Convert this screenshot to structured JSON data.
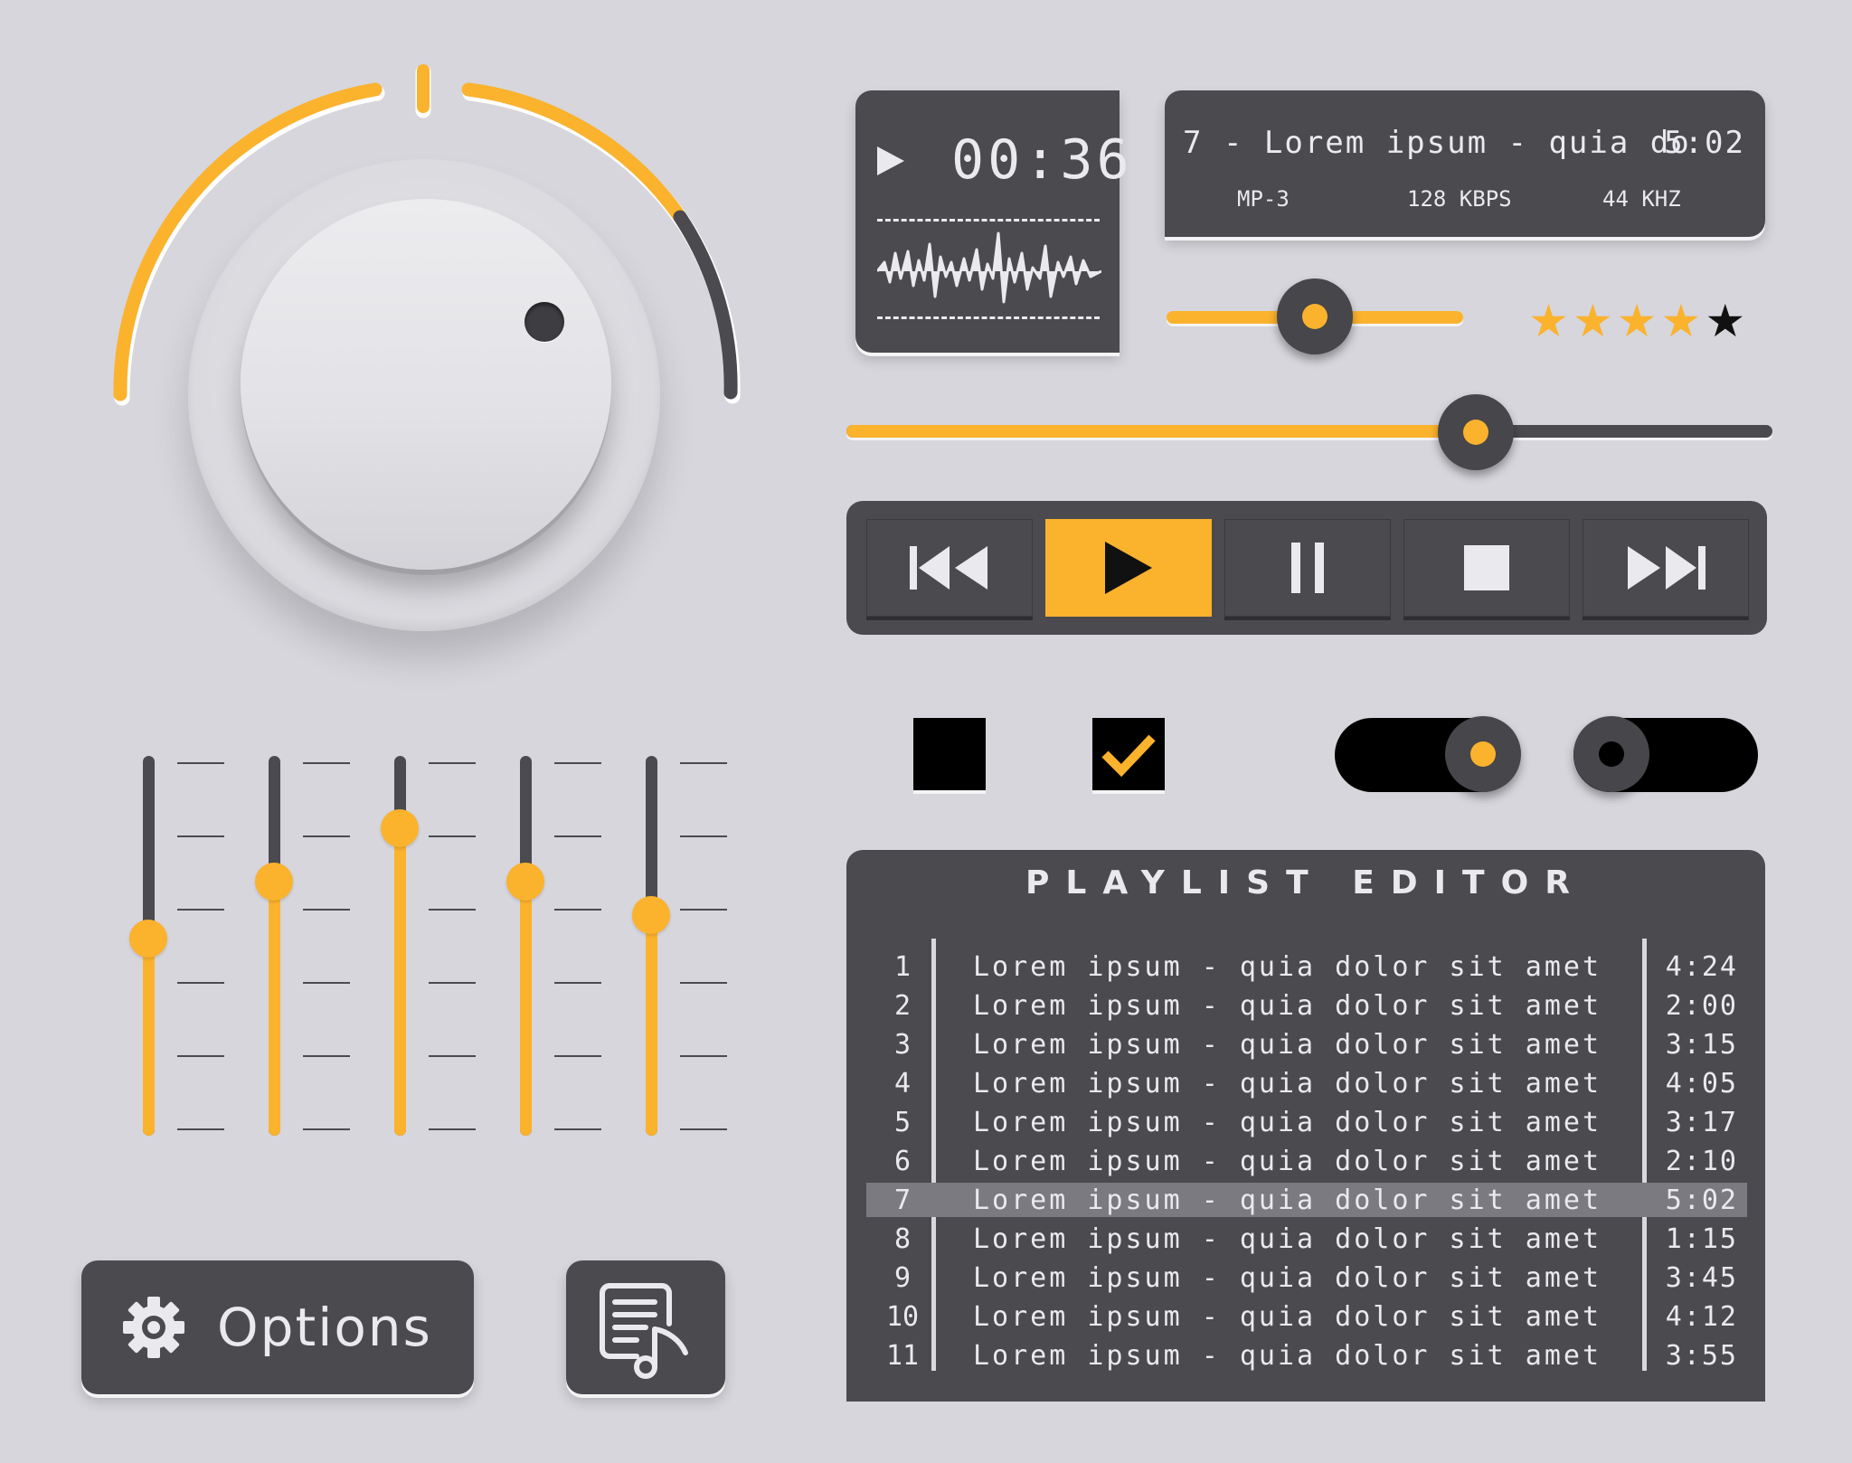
{
  "colors": {
    "accent": "#fbb22d",
    "panel": "#4a4a4f",
    "background": "#d6d6dc"
  },
  "volume_knob": {
    "level_fraction": 0.72
  },
  "equalizer": {
    "bands": [
      0.52,
      0.67,
      0.81,
      0.67,
      0.58
    ]
  },
  "now_playing": {
    "elapsed": "00:36",
    "track": "7 - Lorem ipsum - quia do",
    "duration": "5:02",
    "format": "MP-3",
    "bitrate": "128 KBPS",
    "sample_rate": "44 KHZ"
  },
  "balance_slider": {
    "level_fraction": 0.5
  },
  "rating": {
    "value": 4,
    "max": 5,
    "icon": "star-icon"
  },
  "seek_bar": {
    "level_fraction": 0.68
  },
  "transport": {
    "buttons": [
      "rewind-icon",
      "play-icon",
      "pause-icon",
      "stop-icon",
      "fast-forward-icon"
    ],
    "active": "play-icon"
  },
  "checkboxes": [
    {
      "checked": false
    },
    {
      "checked": true
    }
  ],
  "toggles": [
    {
      "on": true
    },
    {
      "on": false
    }
  ],
  "options_button": {
    "label": "Options",
    "icon": "gear-icon"
  },
  "playlist_button": {
    "icon": "playlist-music-icon"
  },
  "playlist": {
    "title": "PLAYLIST EDITOR",
    "selected_index": 6,
    "rows": [
      {
        "num": "1",
        "title": "Lorem ipsum - quia dolor sit amet",
        "time": "4:24"
      },
      {
        "num": "2",
        "title": "Lorem ipsum - quia dolor sit amet",
        "time": "2:00"
      },
      {
        "num": "3",
        "title": "Lorem ipsum - quia dolor sit amet",
        "time": "3:15"
      },
      {
        "num": "4",
        "title": "Lorem ipsum - quia dolor sit amet",
        "time": "4:05"
      },
      {
        "num": "5",
        "title": "Lorem ipsum - quia dolor sit amet",
        "time": "3:17"
      },
      {
        "num": "6",
        "title": "Lorem ipsum - quia dolor sit amet",
        "time": "2:10"
      },
      {
        "num": "7",
        "title": "Lorem ipsum - quia dolor sit amet",
        "time": "5:02"
      },
      {
        "num": "8",
        "title": "Lorem ipsum - quia dolor sit amet",
        "time": "1:15"
      },
      {
        "num": "9",
        "title": "Lorem ipsum - quia dolor sit amet",
        "time": "3:45"
      },
      {
        "num": "10",
        "title": "Lorem ipsum - quia dolor sit amet",
        "time": "4:12"
      },
      {
        "num": "11",
        "title": "Lorem ipsum - quia dolor sit amet",
        "time": "3:55"
      }
    ]
  }
}
